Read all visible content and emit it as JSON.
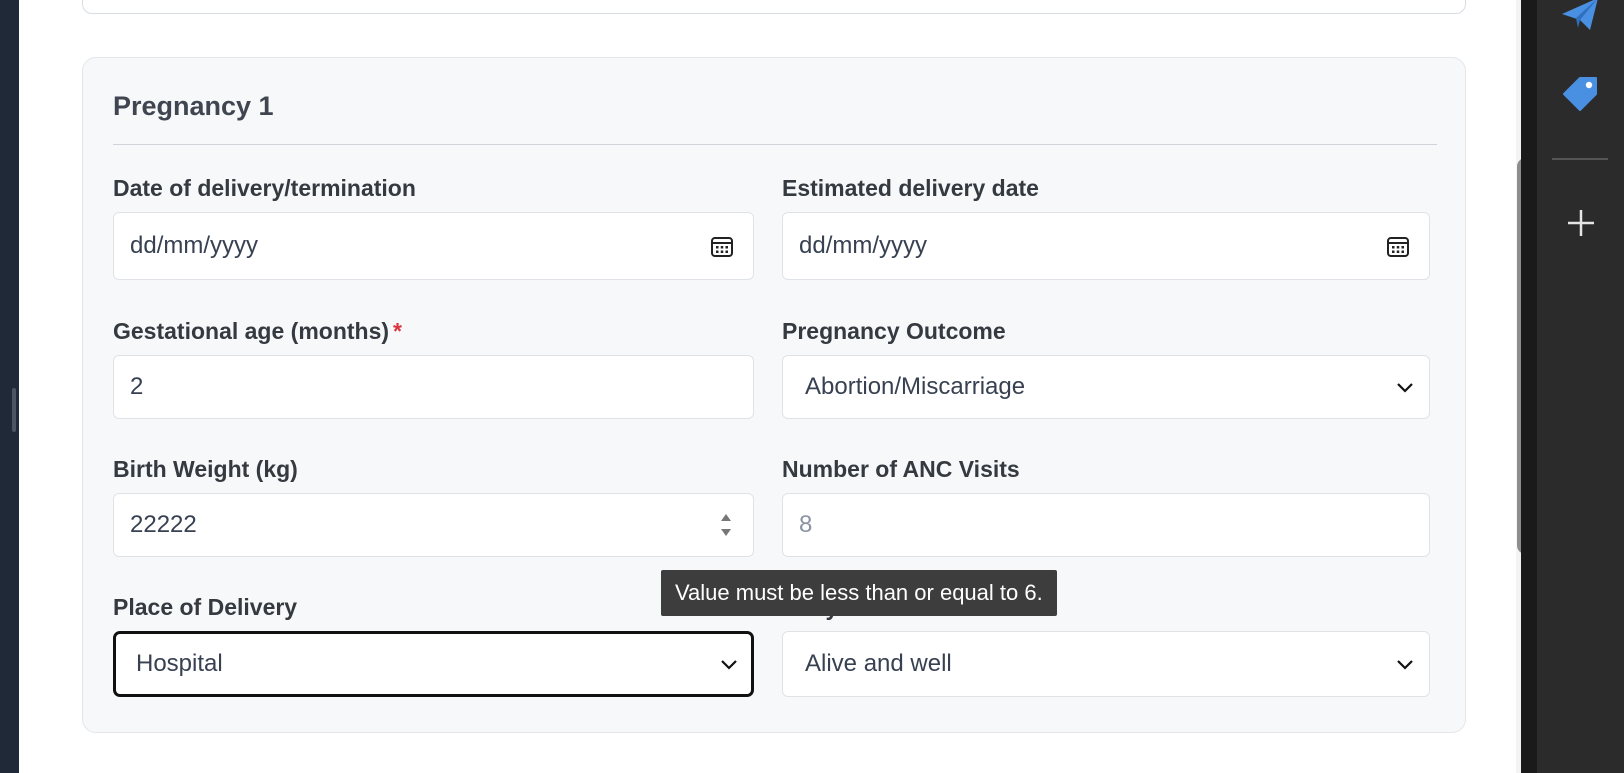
{
  "form": {
    "section_title": "Pregnancy 1",
    "fields": {
      "delivery_date": {
        "label": "Date of delivery/termination",
        "placeholder": "dd/mm/yyyy"
      },
      "estimated_delivery": {
        "label": "Estimated delivery date",
        "placeholder": "dd/mm/yyyy"
      },
      "gestational_age": {
        "label": "Gestational age (months)",
        "required_mark": "*",
        "value": "2"
      },
      "pregnancy_outcome": {
        "label": "Pregnancy Outcome",
        "value": "Abortion/Miscarriage"
      },
      "birth_weight": {
        "label": "Birth Weight (kg)",
        "value": "22222"
      },
      "anc_visits": {
        "label": "Number of ANC Visits",
        "value": "8"
      },
      "place_of_delivery": {
        "label": "Place of Delivery",
        "value": "Hospital"
      },
      "baby_status": {
        "label": "Baby's Current Status",
        "value": "Alive and well"
      }
    },
    "validation_tooltip": "Value must be less than or equal to 6."
  },
  "sidebar_icons": [
    "send-icon",
    "tag-icon",
    "plus-icon"
  ],
  "colors": {
    "accent_blue": "#4a90e2",
    "required_red": "#d9363e",
    "tooltip_bg": "#3d3d3d"
  }
}
